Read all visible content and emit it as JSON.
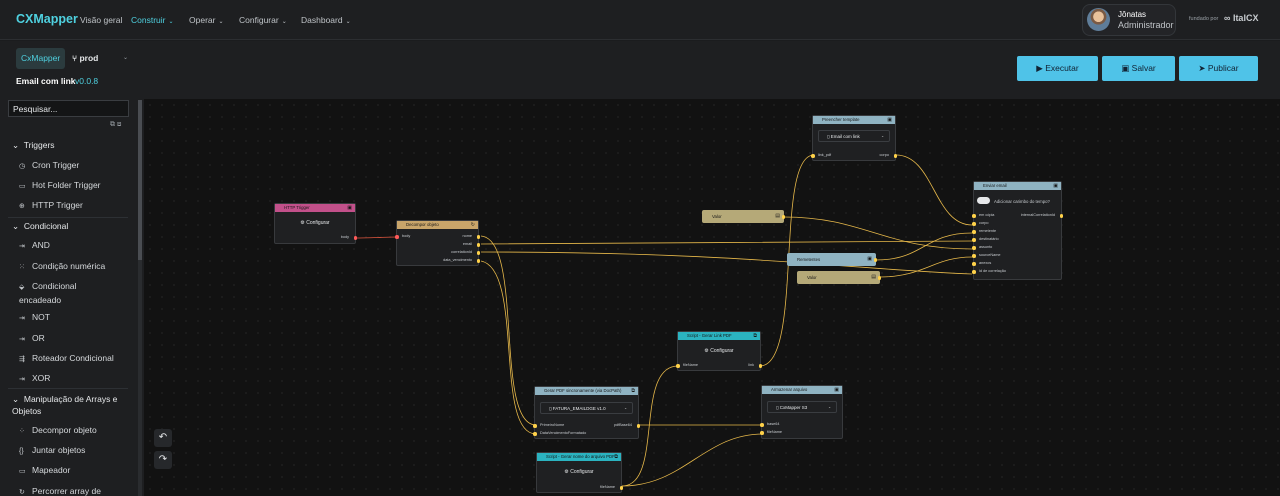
{
  "app": {
    "brand": "CXMapper"
  },
  "nav": {
    "items": [
      {
        "label": "Visão geral",
        "active": false,
        "has_menu": false
      },
      {
        "label": "Construir",
        "active": true,
        "has_menu": true
      },
      {
        "label": "Operar",
        "active": false,
        "has_menu": true
      },
      {
        "label": "Configurar",
        "active": false,
        "has_menu": true
      },
      {
        "label": "Dashboard",
        "active": false,
        "has_menu": true
      }
    ]
  },
  "user": {
    "name": "Jônatas",
    "role": "Administrador"
  },
  "powered": {
    "text": "fundado por",
    "logo": "ItalCX"
  },
  "project": {
    "chip": "CxMapper",
    "branch": "prod",
    "flow_name": "Email com link",
    "version": "v0.0.8"
  },
  "actions": {
    "execute": "Executar",
    "save": "Salvar",
    "publish": "Publicar"
  },
  "sidebar": {
    "search_placeholder": "Pesquisar...",
    "categories": [
      {
        "label": "Triggers",
        "items": [
          {
            "label": "Cron Trigger",
            "icon": "clock-icon"
          },
          {
            "label": "Hot Folder Trigger",
            "icon": "folder-icon"
          },
          {
            "label": "HTTP Trigger",
            "icon": "globe-icon"
          }
        ]
      },
      {
        "label": "Condicional",
        "items": [
          {
            "label": "AND",
            "icon": "and-icon"
          },
          {
            "label": "Condição numérica",
            "icon": "numeric-condition-icon"
          },
          {
            "label": "Condicional encadeado",
            "icon": "chained-condition-icon"
          },
          {
            "label": "NOT",
            "icon": "not-icon"
          },
          {
            "label": "OR",
            "icon": "or-icon"
          },
          {
            "label": "Roteador Condicional",
            "icon": "router-icon"
          },
          {
            "label": "XOR",
            "icon": "xor-icon"
          }
        ]
      },
      {
        "label": "Manipulação de Arrays e Objetos",
        "items": [
          {
            "label": "Decompor objeto",
            "icon": "decompose-icon"
          },
          {
            "label": "Juntar objetos",
            "icon": "join-icon"
          },
          {
            "label": "Mapeador",
            "icon": "map-icon"
          },
          {
            "label": "Percorrer array de",
            "icon": "loop-icon"
          }
        ]
      }
    ]
  },
  "colors": {
    "accent": "#4fd1e0",
    "button": "#4fc3e8",
    "http": "#c2508a",
    "decompose": "#c9a56a",
    "value": "#b5a978",
    "teal": "#2bb3c0",
    "gray": "#8fb3c2",
    "wire": "#e6b84a",
    "wire_red": "#e0573f"
  },
  "nodes": {
    "http": {
      "title": "HTTP Trigger",
      "config": "Configurar",
      "out": [
        "body"
      ]
    },
    "decompor": {
      "title": "Decompor objeto",
      "in": [
        "body"
      ],
      "out": [
        "nome",
        "email",
        "correlationId",
        "data_vencimento"
      ]
    },
    "template": {
      "title": "Preencher template",
      "select": "Email com link",
      "in": [
        "link_pdf"
      ],
      "out": [
        "corpo"
      ]
    },
    "enviar": {
      "title": "Enviar email",
      "toggle_label": "Adicionar carimbo do tempo?",
      "in": [
        "em cópia",
        "corpo",
        "remetente",
        "destinatário",
        "assunto",
        "sourceName",
        "anexos",
        "id de correlação"
      ],
      "out": [
        "internalCorrelationId"
      ]
    },
    "valor1": {
      "title": "Valor"
    },
    "remetentes": {
      "title": "Remetentes"
    },
    "valor2": {
      "title": "Valor"
    },
    "gerarlink": {
      "title": "Script - Gerar Link PDF",
      "config": "Configurar",
      "in": [
        "fileName"
      ],
      "out": [
        "link"
      ]
    },
    "gerarpdf": {
      "title": "Gerar PDF sincronamente (via DocPath)",
      "select": "FATURA_EMAILDGE v1.0",
      "in": [
        "PrimeiroNome",
        "DataVencimentoFormatado"
      ],
      "out": [
        "pdfBase64"
      ]
    },
    "armazenar": {
      "title": "Armazenar arquivo",
      "select": "CxMapper S3",
      "in": [
        "base64",
        "fileName"
      ]
    },
    "gerarnome": {
      "title": "Script - Gerar nome do arquivo PDF",
      "config": "Configurar",
      "out": [
        "fileName"
      ]
    }
  }
}
